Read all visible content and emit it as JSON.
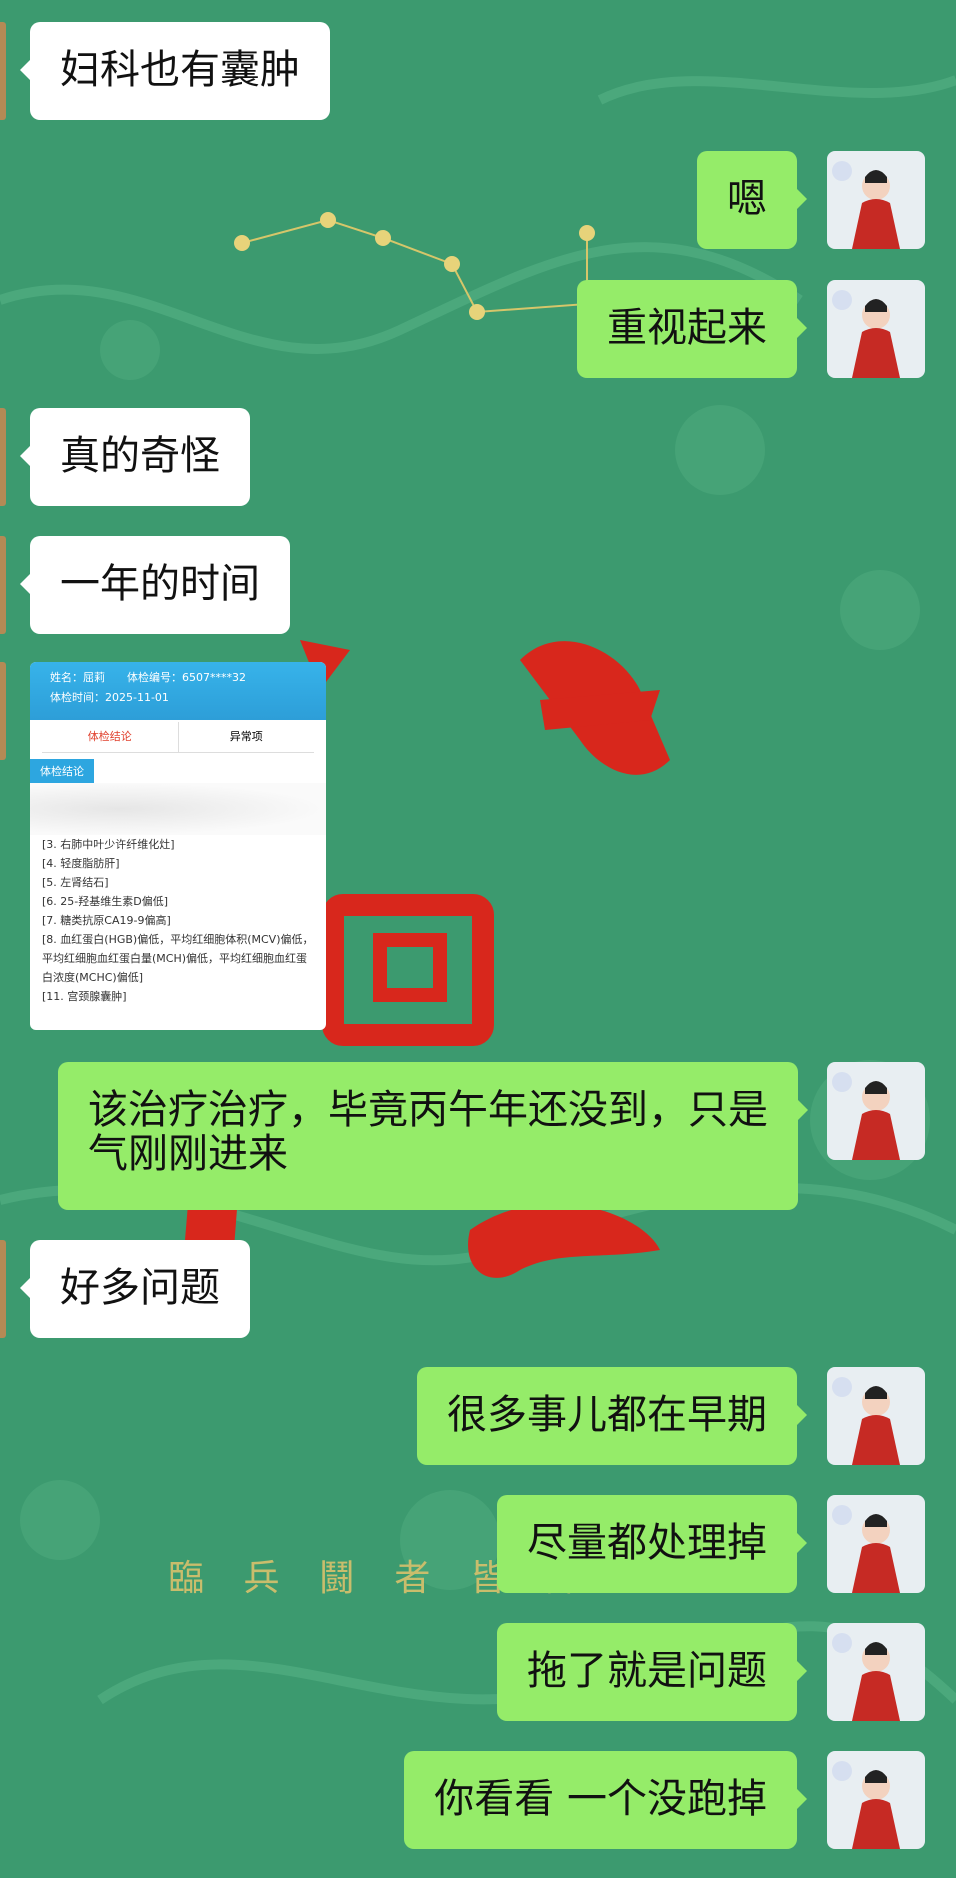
{
  "messages": [
    {
      "side": "left",
      "text": "妇科也有囊肿"
    },
    {
      "side": "right",
      "text": "嗯"
    },
    {
      "side": "right",
      "text": "重视起来"
    },
    {
      "side": "left",
      "text": "真的奇怪"
    },
    {
      "side": "left",
      "text": "一年的时间"
    },
    {
      "side": "right",
      "text": "该治疗治疗，毕竟丙午年还没到，只是气刚刚进来"
    },
    {
      "side": "left",
      "text": "好多问题"
    },
    {
      "side": "right",
      "text": "很多事儿都在早期"
    },
    {
      "side": "right",
      "text": "尽量都处理掉"
    },
    {
      "side": "right",
      "text": "拖了就是问题"
    },
    {
      "side": "right",
      "text": "你看看 一个没跑掉"
    }
  ],
  "report": {
    "name_line": "姓名：屈莉　　体检编号：6507****32",
    "time_line": "体检时间：2025-11-01",
    "tab_conclusion": "体检结论",
    "tab_abnormal": "异常项",
    "section": "体检结论",
    "items": [
      "[3. 右肺中叶少许纤维化灶]",
      "[4. 轻度脂肪肝]",
      "[5. 左肾结石]",
      "[6. 25-羟基维生素D偏低]",
      "[7. 糖类抗原CA19-9偏高]",
      "[8. 血红蛋白(HGB)偏低，平均红细胞体积(MCV)偏低，平均红细胞血红蛋白量(MCH)偏低，平均红细胞血红蛋白浓度(MCHC)偏低]",
      "[11. 宫颈腺囊肿]"
    ]
  },
  "background_text": "臨 兵 鬪 者 皆 陣",
  "colors": {
    "background": "#3c9a6f",
    "bubble_self": "#95ec69",
    "bubble_other": "#ffffff",
    "seal_red": "#d8271c"
  }
}
